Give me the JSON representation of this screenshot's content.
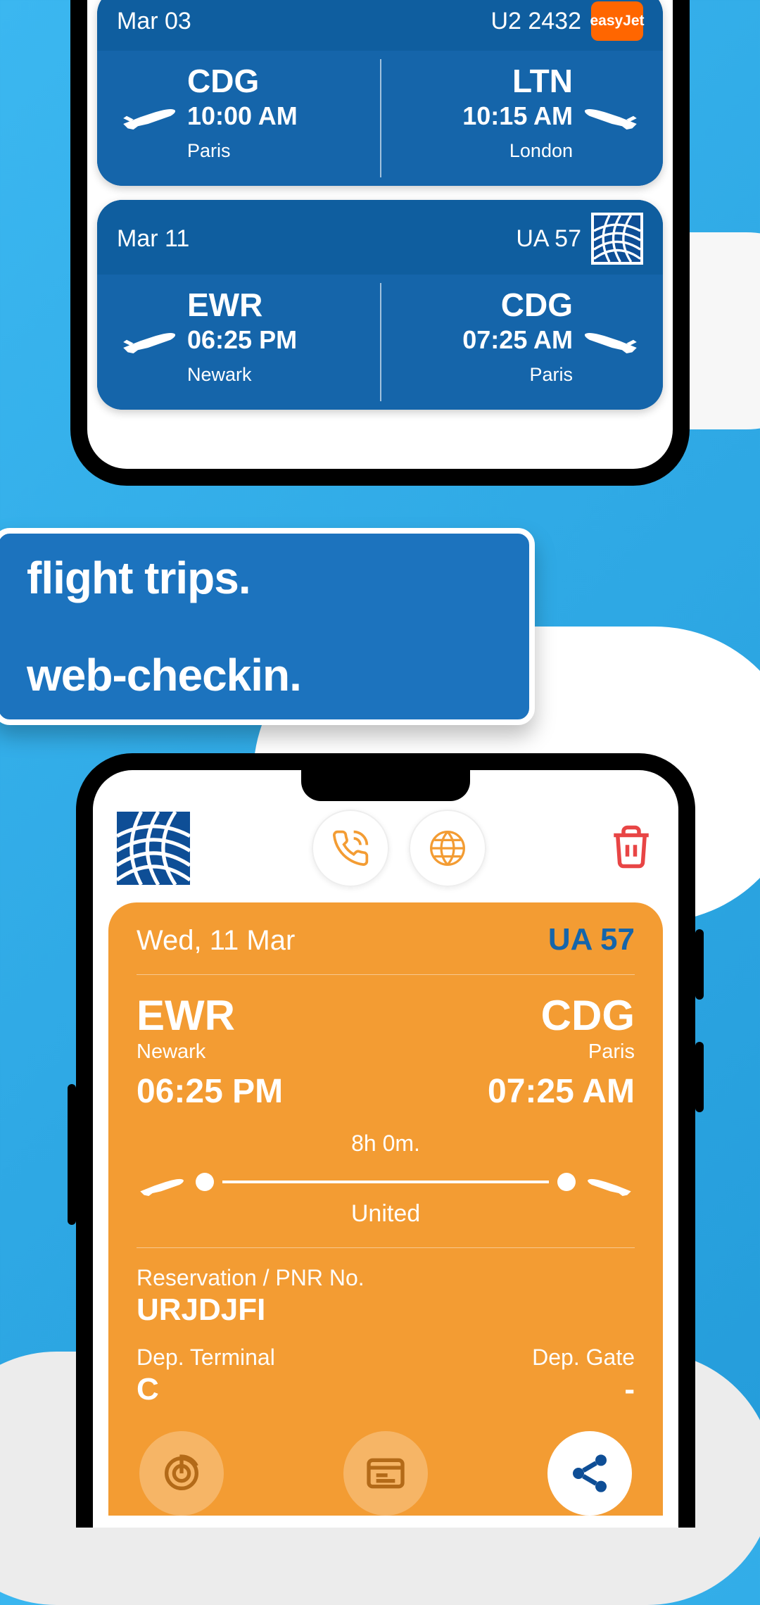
{
  "promo": {
    "line1": "flight trips.",
    "line2": "web-checkin."
  },
  "flights": [
    {
      "date": "Mar 03",
      "number": "U2 2432",
      "airline_logo": "easyJet",
      "dep": {
        "code": "CDG",
        "time": "10:00 AM",
        "city": "Paris"
      },
      "arr": {
        "code": "LTN",
        "time": "10:15 AM",
        "city": "London"
      }
    },
    {
      "date": "Mar 11",
      "number": "UA 57",
      "airline_logo": "united",
      "dep": {
        "code": "EWR",
        "time": "06:25 PM",
        "city": "Newark"
      },
      "arr": {
        "code": "CDG",
        "time": "07:25 AM",
        "city": "Paris"
      }
    }
  ],
  "detail": {
    "date": "Wed, 11 Mar",
    "number": "UA 57",
    "dep": {
      "code": "EWR",
      "city": "Newark",
      "time": "06:25 PM"
    },
    "arr": {
      "code": "CDG",
      "city": "Paris",
      "time": "07:25 AM"
    },
    "duration": "8h 0m.",
    "airline": "United",
    "pnr_label": "Reservation / PNR No.",
    "pnr": "URJDJFI",
    "dep_terminal_label": "Dep. Terminal",
    "dep_terminal": "C",
    "dep_gate_label": "Dep. Gate",
    "dep_gate": "-"
  }
}
